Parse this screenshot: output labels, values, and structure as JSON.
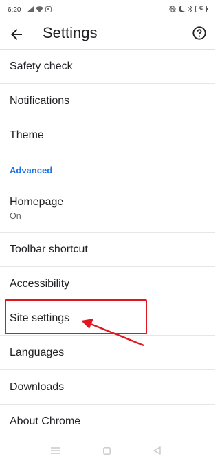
{
  "status_bar": {
    "time": "6:20",
    "battery": "42"
  },
  "app_bar": {
    "title": "Settings"
  },
  "settings": {
    "safety_check": "Safety check",
    "notifications": "Notifications",
    "theme": "Theme",
    "advanced_header": "Advanced",
    "homepage": "Homepage",
    "homepage_status": "On",
    "toolbar_shortcut": "Toolbar shortcut",
    "accessibility": "Accessibility",
    "site_settings": "Site settings",
    "languages": "Languages",
    "downloads": "Downloads",
    "about_chrome": "About Chrome"
  },
  "colors": {
    "accent": "#1a73e8",
    "annotation": "#e0171f"
  },
  "icons": {
    "back": "arrow-back-icon",
    "help": "help-icon"
  }
}
